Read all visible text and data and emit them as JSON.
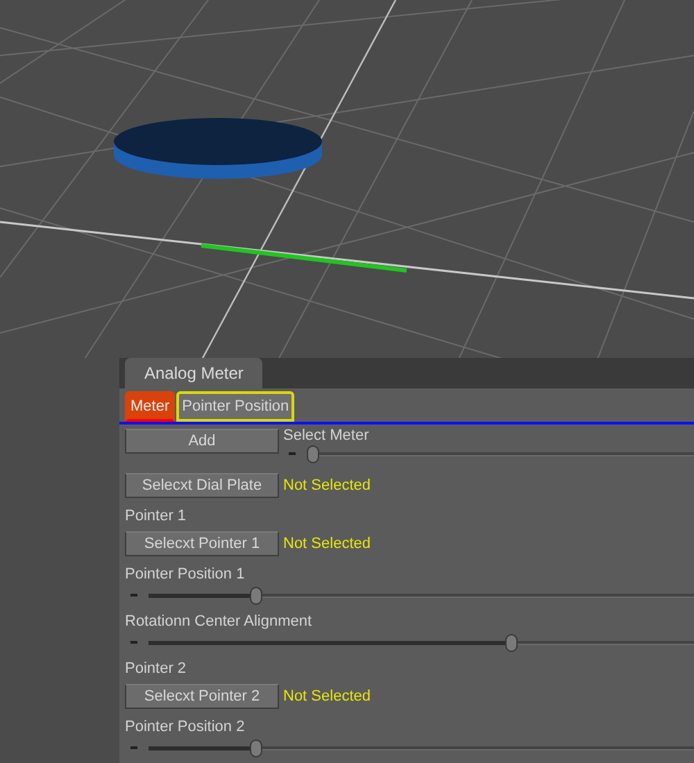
{
  "panel": {
    "title": "Analog Meter",
    "tabs": [
      {
        "label": "Meter",
        "selected": true,
        "focused": false
      },
      {
        "label": "Pointer Position",
        "selected": false,
        "focused": true
      }
    ],
    "rows": [
      {
        "kind": "button_slider",
        "button": "Add",
        "label": "Select Meter",
        "level": 0
      },
      {
        "kind": "button_status",
        "button": "Selecxt Dial Plate",
        "status": "Not Selected"
      },
      {
        "kind": "label",
        "text": "Pointer 1"
      },
      {
        "kind": "button_status",
        "button": "Selecxt Pointer 1",
        "status": "Not Selected"
      },
      {
        "kind": "slider",
        "label": "Pointer Position 1",
        "level": 0.19
      },
      {
        "kind": "slider",
        "label": "Rotationn Center Alignment",
        "level": 0.67
      },
      {
        "kind": "label",
        "text": "Pointer 2"
      },
      {
        "kind": "button_status",
        "button": "Selecxt Pointer 2",
        "status": "Not Selected"
      },
      {
        "kind": "slider",
        "label": "Pointer Position 2",
        "level": 0.19
      }
    ]
  }
}
